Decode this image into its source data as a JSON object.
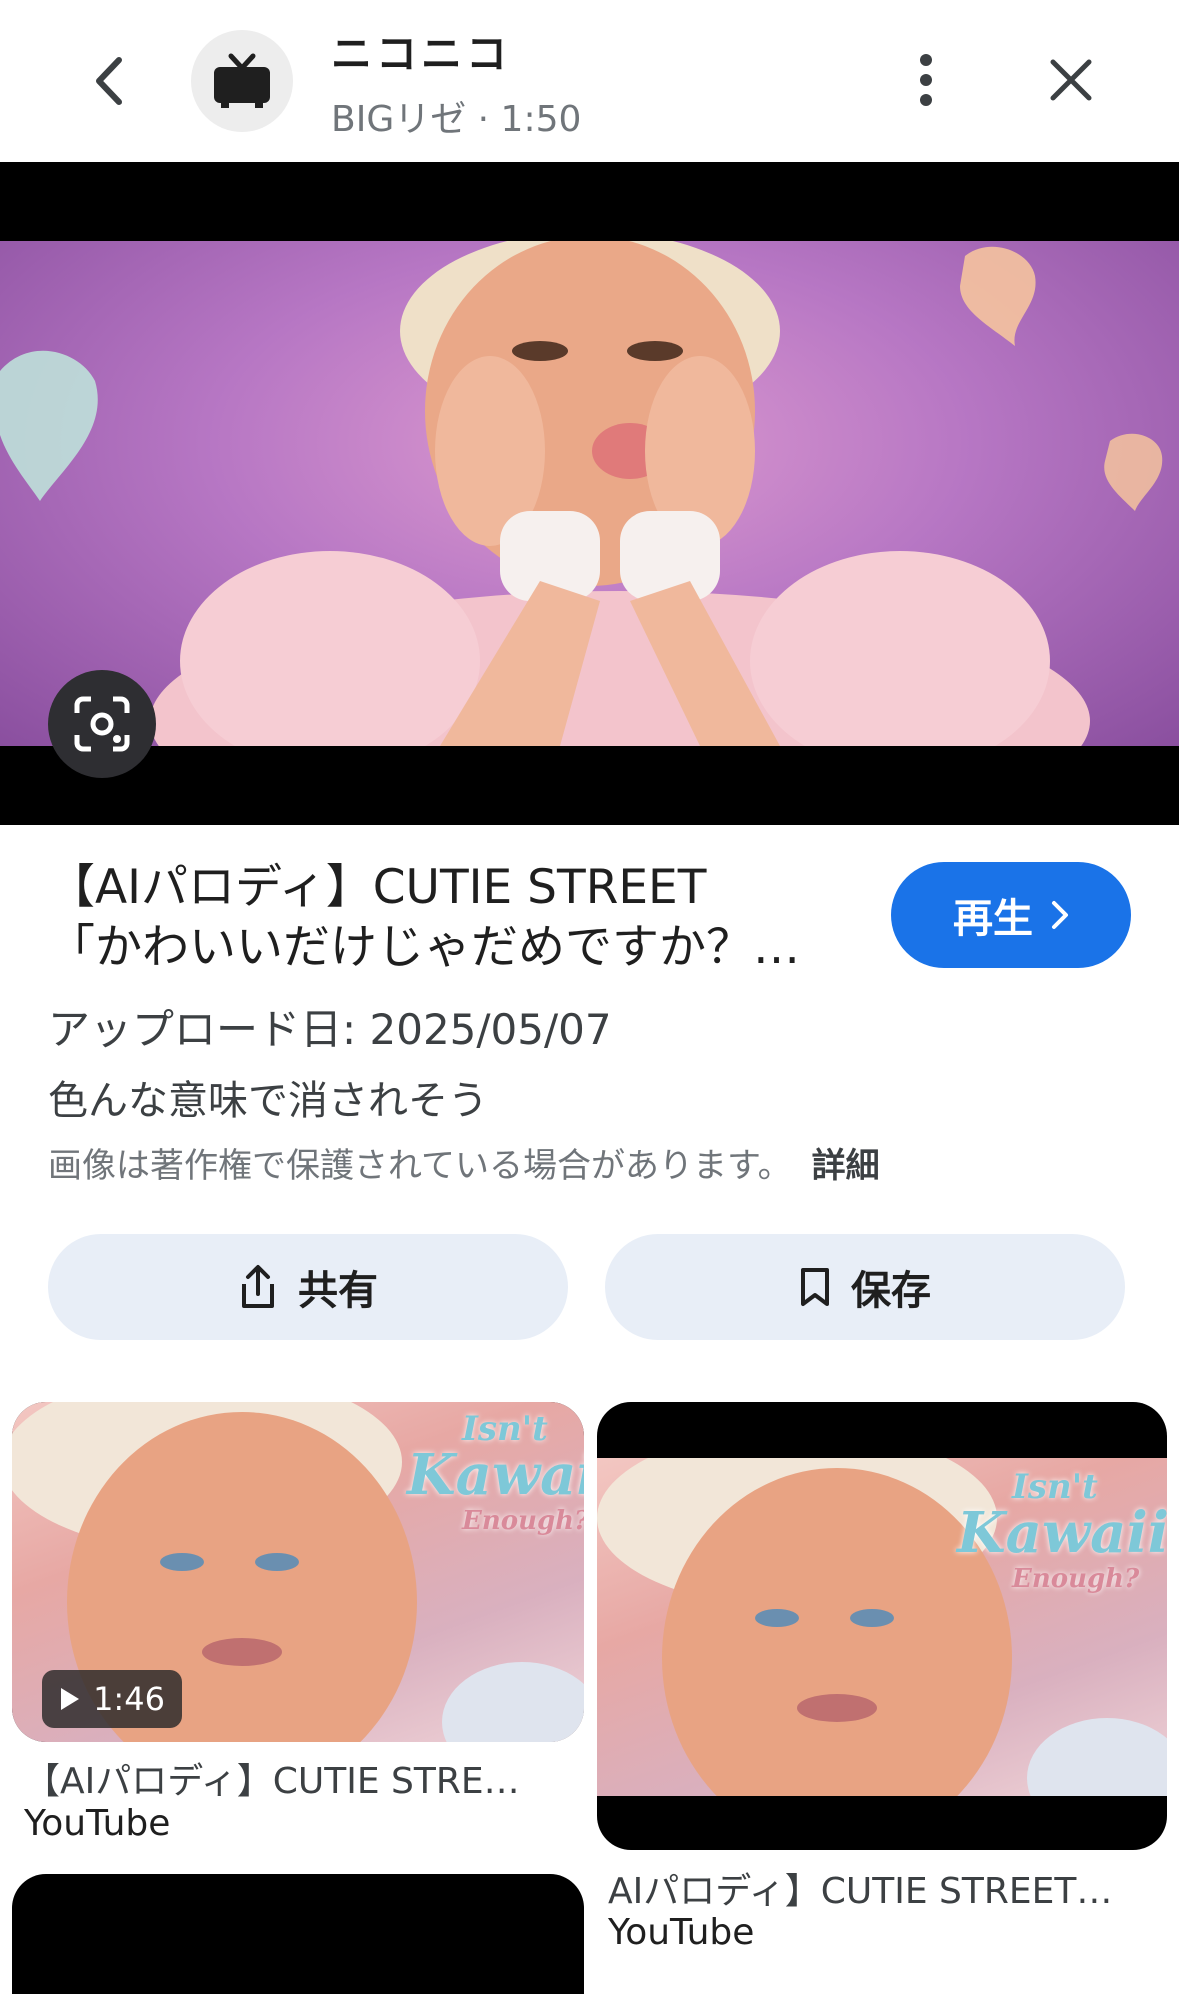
{
  "header": {
    "site_name": "ニコニコ",
    "subtitle": "BIGリゼ · 1:50"
  },
  "main": {
    "title_line1": "【AIパロディ】CUTIE STREET",
    "title_line2": "「かわいいだけじゃだめですか？…",
    "play_label": "再生",
    "upload_date": "アップロード日: 2025/05/07",
    "description": "色んな意味で消されそう",
    "copyright_notice": "画像は著作権で保護されている場合があります。",
    "detail_link": "詳細",
    "share_label": "共有",
    "save_label": "保存"
  },
  "related": [
    {
      "title": "【AIパロディ】CUTIE STRE…",
      "source": "YouTube",
      "duration": "1:46",
      "overlay_text": [
        "Isn't",
        "Kawaii",
        "Enough?"
      ]
    },
    {
      "title": "AIパロディ】CUTIE STREET…",
      "source": "YouTube",
      "overlay_text": [
        "Isn't",
        "Kawaii",
        "Enough?"
      ]
    }
  ],
  "colors": {
    "accent": "#1a73e8",
    "action_bg": "#e8eef7"
  }
}
